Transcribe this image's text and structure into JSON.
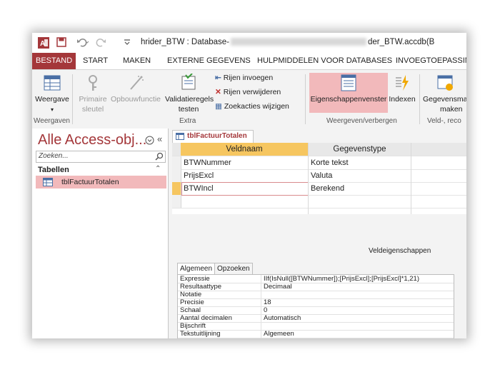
{
  "window": {
    "title_prefix": "hrider_BTW : Database-",
    "title_suffix": "der_BTW.accdb(B"
  },
  "tabs": [
    "BESTAND",
    "START",
    "MAKEN",
    "EXTERNE GEGEVENS",
    "HULPMIDDELEN VOOR DATABASES",
    "INVOEGTOEPASSING"
  ],
  "ribbon": {
    "weergave": "Weergave",
    "primaire_sleutel_1": "Primaire",
    "primaire_sleutel_2": "sleutel",
    "opbouwfunctie": "Opbouwfunctie",
    "validatieregels_1": "Validatieregels",
    "validatieregels_2": "testen",
    "rijen_invoegen": "Rijen invoegen",
    "rijen_verwijderen": "Rijen verwijderen",
    "zoekacties_wijzigen": "Zoekacties wijzigen",
    "eigenschappenvenster": "Eigenschappenvenster",
    "indexen": "Indexen",
    "gegevensmakro_1": "Gegevensma",
    "gegevensmakro_2": "maken",
    "groups": {
      "weergaven": "Weergaven",
      "extra": "Extra",
      "weergeven_verbergen": "Weergeven/verbergen",
      "veld_record": "Veld-, reco"
    }
  },
  "nav": {
    "title": "Alle Access-obj...",
    "search_placeholder": "Zoeken...",
    "section": "Tabellen",
    "item": "tblFactuurTotalen"
  },
  "document": {
    "tab_title": "tblFactuurTotalen",
    "col_veldnaam": "Veldnaam",
    "col_gegevenstype": "Gegevenstype",
    "rows": [
      {
        "name": "BTWNummer",
        "type": "Korte tekst"
      },
      {
        "name": "PrijsExcl",
        "type": "Valuta"
      },
      {
        "name": "BTWIncl",
        "type": "Berekend"
      }
    ],
    "veldeigenschappen": "Veldeigenschappen",
    "prop_tabs": [
      "Algemeen",
      "Opzoeken"
    ],
    "props": [
      {
        "name": "Expressie",
        "value": "IIf(IsNull([BTWNummer]);[PrijsExcl];[PrijsExcl]*1,21)"
      },
      {
        "name": "Resultaattype",
        "value": "Decimaal"
      },
      {
        "name": "Notatie",
        "value": ""
      },
      {
        "name": "Precisie",
        "value": "18"
      },
      {
        "name": "Schaal",
        "value": "0"
      },
      {
        "name": "Aantal decimalen",
        "value": "Automatisch"
      },
      {
        "name": "Bijschrift",
        "value": ""
      },
      {
        "name": "Tekstuitlijning",
        "value": "Algemeen"
      }
    ]
  },
  "colors": {
    "accent": "#a4373a",
    "selection": "#f2b9bb"
  }
}
